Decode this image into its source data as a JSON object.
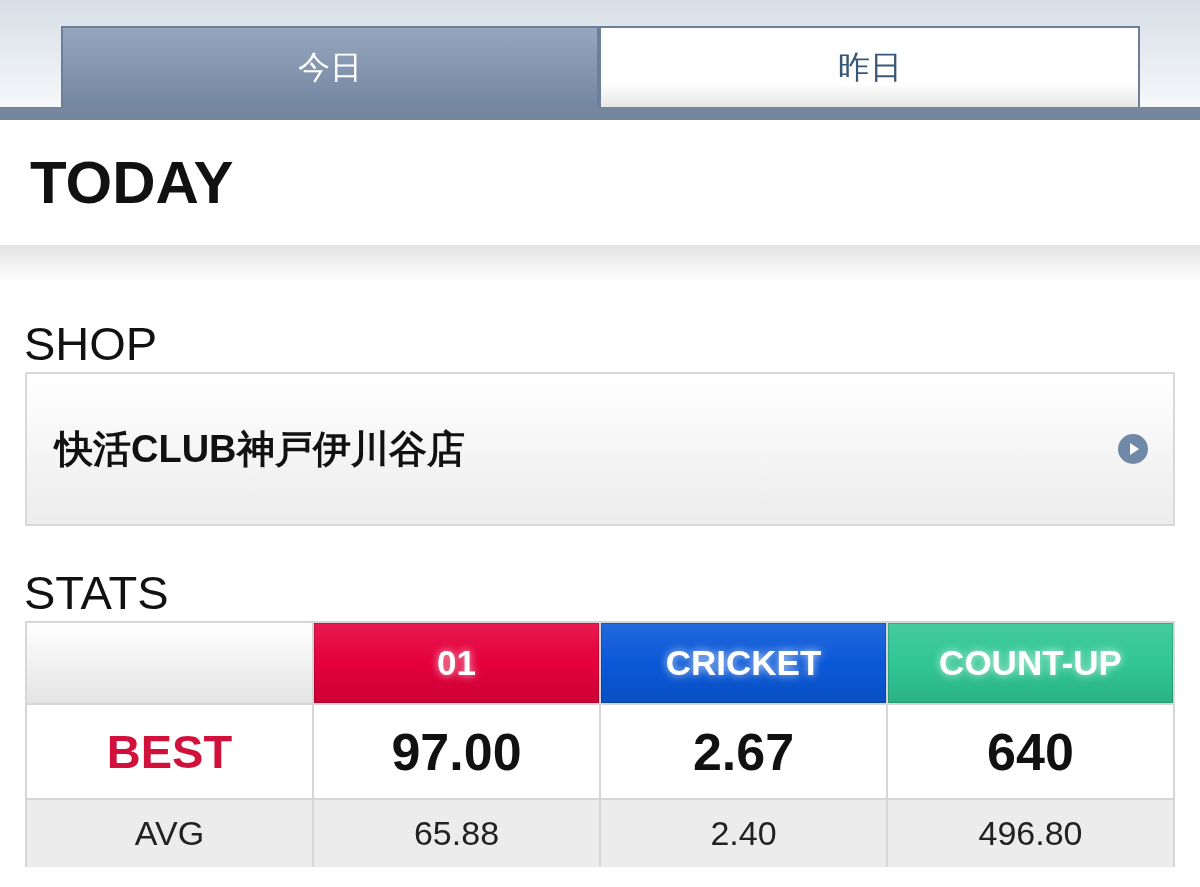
{
  "tabs": [
    {
      "label": "今日",
      "selected": true
    },
    {
      "label": "昨日",
      "selected": false
    }
  ],
  "page_title": "TODAY",
  "shop": {
    "heading": "SHOP",
    "name": "快活CLUB神戸伊川谷店"
  },
  "stats": {
    "heading": "STATS",
    "columns": [
      {
        "label": "01",
        "color": "#e4003c"
      },
      {
        "label": "CRICKET",
        "color": "#0a58d8"
      },
      {
        "label": "COUNT-UP",
        "color": "#30c693"
      }
    ],
    "rows": [
      {
        "kind": "best",
        "label": "BEST",
        "values": [
          "97.00",
          "2.67",
          "640"
        ]
      },
      {
        "kind": "avg",
        "label": "AVG",
        "values": [
          "65.88",
          "2.40",
          "496.80"
        ]
      }
    ]
  }
}
